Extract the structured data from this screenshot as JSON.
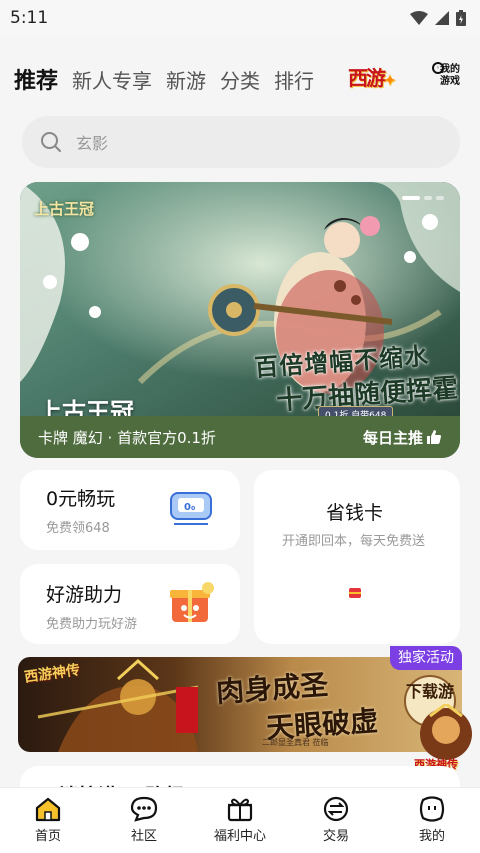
{
  "status_bar": {
    "time": "5:11"
  },
  "top_nav": {
    "tabs": [
      {
        "label": "推荐",
        "active": true
      },
      {
        "label": "新人专享",
        "active": false
      },
      {
        "label": "新游",
        "active": false
      },
      {
        "label": "分类",
        "active": false
      },
      {
        "label": "排行",
        "active": false
      }
    ],
    "brand_logo": "西游",
    "my_games": "我的游戏",
    "my_games_icon": "game-controller-icon"
  },
  "search": {
    "placeholder": "玄影"
  },
  "banner": {
    "logo": "上古王冠",
    "slogan_line1": "百倍增幅不缩水",
    "slogan_line2": "十万抽随便挥霍",
    "badge": "0.1折 自带648",
    "title": "上古王冠",
    "subtitle": "卡牌 魔幻 · 首款官方0.1折",
    "daily_pick": "每日主推"
  },
  "cards": {
    "zero_yuan": {
      "title": "0元畅玩",
      "subtitle": "免费领648"
    },
    "save_card": {
      "title": "省钱卡",
      "subtitle": "开通即回本，每天免费送"
    },
    "assist": {
      "title": "好游助力",
      "subtitle": "免费助力玩好游"
    }
  },
  "promo": {
    "tag": "独家活动",
    "logo": "西游神传",
    "line1": "肉身成圣",
    "line2": "天眼破虚",
    "caption": "二郎显圣真君 莅临",
    "download": "下载游",
    "corner_logo": "西游神传"
  },
  "next_section": {
    "title": "三端拉满 一路畅玩"
  },
  "bottom_nav": {
    "items": [
      {
        "label": "首页",
        "icon": "home-icon",
        "active": true
      },
      {
        "label": "社区",
        "icon": "chat-icon",
        "active": false
      },
      {
        "label": "福利中心",
        "icon": "gift-icon",
        "active": false
      },
      {
        "label": "交易",
        "icon": "exchange-icon",
        "active": false
      },
      {
        "label": "我的",
        "icon": "profile-icon",
        "active": false
      }
    ]
  },
  "colors": {
    "accent": "#f6c12a",
    "promo_tag": "#7b3fe4",
    "banner_bar": "#4f6c3e"
  }
}
